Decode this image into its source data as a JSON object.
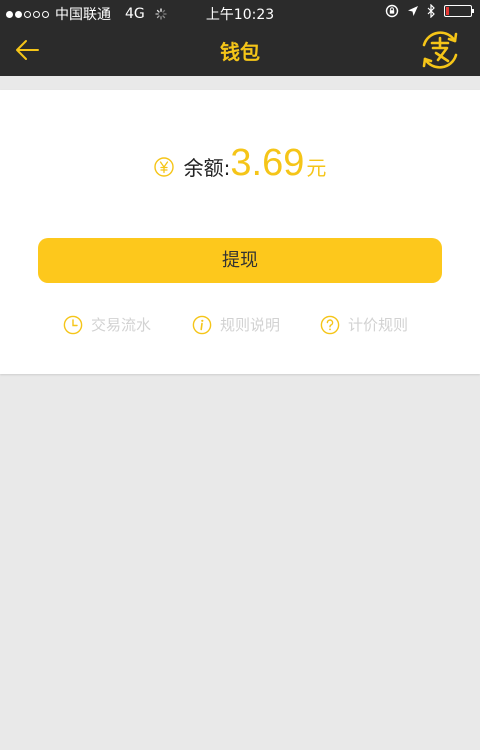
{
  "status_bar": {
    "carrier": "中国联通",
    "network": "4G",
    "time": "上午10:23",
    "signal_bars_filled": 2,
    "signal_bars_total": 5,
    "battery_level": 0.12
  },
  "nav": {
    "title": "钱包",
    "back_icon": "arrow-left-icon",
    "right_icon": "alipay-exchange-icon"
  },
  "balance": {
    "icon": "yen-icon",
    "label": "余额:",
    "amount": "3.69",
    "unit": "元"
  },
  "withdraw_button": {
    "label": "提现"
  },
  "links": [
    {
      "icon": "clock-icon",
      "label": "交易流水"
    },
    {
      "icon": "info-icon",
      "label": "规则说明"
    },
    {
      "icon": "question-icon",
      "label": "计价规则"
    }
  ],
  "colors": {
    "accent": "#f5c518",
    "button": "#fdc81c",
    "topbar": "#2b2b2b",
    "background": "#e9e9e9",
    "link_text": "#d2d2d2"
  }
}
